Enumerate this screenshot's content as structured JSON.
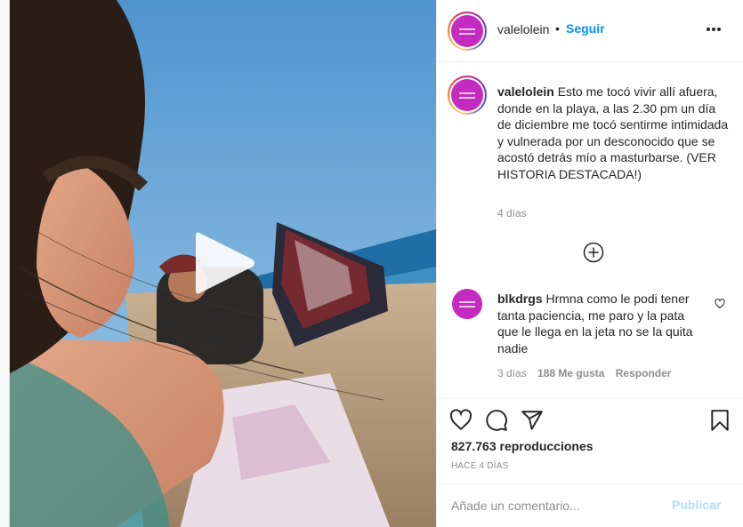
{
  "post": {
    "username": "valelolein",
    "separator": "•",
    "follow_label": "Seguir",
    "more_icon": "more-options-icon"
  },
  "caption": {
    "username": "valelolein",
    "text": "Esto me tocó vivir allí afuera, donde en la playa, a las 2.30 pm un día de diciembre me tocó sentirme intimidada y vulnerada por un desconocido que se acostó detrás mío a masturbarse. (VER HISTORIA DESTACADA!)",
    "age": "4 días"
  },
  "load_more_icon": "plus-circle-icon",
  "comments": [
    {
      "username": "blkdrgs",
      "text": "Hrmna como le podi tener tanta paciencia, me paro y la pata que le llega en la jeta no se la quita nadie",
      "age": "3 días",
      "likes": "188 Me gusta",
      "reply": "Responder"
    }
  ],
  "stats": {
    "views": "827.763 reproducciones",
    "posted": "HACE 4 DÍAS"
  },
  "composer": {
    "placeholder": "Añade un comentario...",
    "publish_label": "Publicar"
  },
  "colors": {
    "link_blue": "#0095f6",
    "publish_disabled": "#b2dffc",
    "avatar_magenta": "#c42bbf",
    "muted_text": "#8e8e8e"
  }
}
